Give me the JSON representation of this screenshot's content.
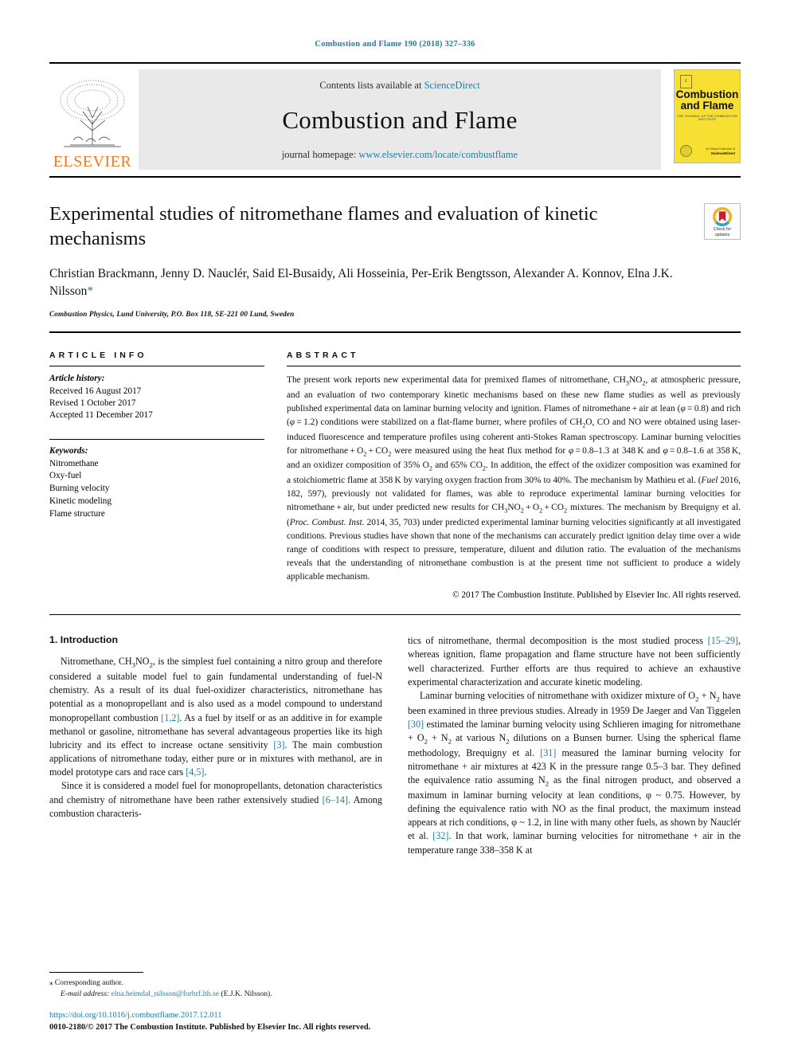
{
  "running_head": "Combustion and Flame 190 (2018) 327–336",
  "masthead": {
    "publisher_name": "ELSEVIER",
    "contents_prefix": "Contents lists available at ",
    "contents_link": "ScienceDirect",
    "journal_title": "Combustion and Flame",
    "homepage_prefix": "journal homepage: ",
    "homepage_link": "www.elsevier.com/locate/combustflame",
    "cover": {
      "title_line1": "Combustion",
      "title_line2": "and Flame",
      "subtitle": "THE JOURNAL OF THE COMBUSTION INSTITUTE",
      "footer_small": "An Official Publication of",
      "footer_bold": "ScienceDirect"
    }
  },
  "article": {
    "title": "Experimental studies of nitromethane flames and evaluation of kinetic mechanisms",
    "authors": "Christian Brackmann, Jenny D. Nauclér, Said El-Busaidy, Ali Hosseinia, Per-Erik Bengtsson, Alexander A. Konnov, Elna J.K. Nilsson",
    "corresponding_marker": "*",
    "affiliation": "Combustion Physics, Lund University, P.O. Box 118, SE-221 00 Lund, Sweden"
  },
  "crossmark": {
    "line1": "Check for",
    "line2": "updates"
  },
  "info": {
    "heading": "ARTICLE INFO",
    "history_label": "Article history:",
    "history": [
      "Received 16 August 2017",
      "Revised 1 October 2017",
      "Accepted 11 December 2017"
    ],
    "keywords_label": "Keywords:",
    "keywords": [
      "Nitromethane",
      "Oxy-fuel",
      "Burning velocity",
      "Kinetic modeling",
      "Flame structure"
    ]
  },
  "abstract": {
    "heading": "ABSTRACT",
    "copyright": "© 2017 The Combustion Institute. Published by Elsevier Inc. All rights reserved."
  },
  "intro": {
    "section_title": "1. Introduction",
    "left_p1_a": "Nitromethane, CH",
    "left_p1_b": "3",
    "left_p1_c": "NO",
    "left_p1_d": "2",
    "left_p1_e": ", is the simplest fuel containing a nitro group and therefore considered a suitable model fuel to gain fundamental understanding of fuel-N chemistry. As a result of its dual fuel-oxidizer characteristics, nitromethane has potential as a monopropellant and is also used as a model compound to understand monopropellant combustion ",
    "ref_1_2": "[1,2]",
    "left_p1_f": ". As a fuel by itself or as an additive in for example methanol or gasoline, nitromethane has several advantageous properties like its high lubricity and its effect to increase octane sensitivity ",
    "ref_3": "[3]",
    "left_p1_g": ". The main combustion applications of nitromethane today, either pure or in mixtures with methanol, are in model prototype cars and race cars ",
    "ref_4_5": "[4,5]",
    "left_p1_h": ".",
    "left_p2_a": "Since it is considered a model fuel for monopropellants, detonation characteristics and chemistry of nitromethane have been rather extensively studied ",
    "ref_6_14": "[6–14]",
    "left_p2_b": ". Among combustion characteris-",
    "right_p1_a": "tics of nitromethane, thermal decomposition is the most studied process ",
    "ref_15_29": "[15–29]",
    "right_p1_b": ", whereas ignition, flame propagation and flame structure have not been sufficiently well characterized. Further efforts are thus required to achieve an exhaustive experimental characterization and accurate kinetic modeling.",
    "right_p2_a": "Laminar burning velocities of nitromethane with oxidizer mixture of O",
    "right_p2_b": "2",
    "right_p2_c": " + N",
    "right_p2_d": "2",
    "right_p2_e": " have been examined in three previous studies. Already in 1959 De Jaeger and Van Tiggelen ",
    "ref_30": "[30]",
    "right_p2_f": " estimated the laminar burning velocity using Schlieren imaging for nitromethane + O",
    "right_p2_g": "2",
    "right_p2_h": " + N",
    "right_p2_i": "2",
    "right_p2_j": " at various N",
    "right_p2_k": "2",
    "right_p2_l": " dilutions on a Bunsen burner. Using the spherical flame methodology, Brequigny et al. ",
    "ref_31": "[31]",
    "right_p2_m": " measured the laminar burning velocity for nitromethane + air mixtures at 423 K in the pressure range 0.5–3 bar. They defined the equivalence ratio assuming N",
    "right_p2_n": "2",
    "right_p2_o": " as the final nitrogen product, and observed a maximum in laminar burning velocity at lean conditions, φ ~ 0.75. However, by defining the equivalence ratio with NO as the final product, the maximum instead appears at rich conditions, φ ~ 1.2, in line with many other fuels, as shown by Nauclér et al. ",
    "ref_32": "[32]",
    "right_p2_p": ". In that work, laminar burning velocities for nitromethane + air in the temperature range 338–358 K at"
  },
  "footnote": {
    "corresponding": "Corresponding author.",
    "email_label": "E-mail address:",
    "email": "elna.heimdal_nilsson@forbrf.lth.se",
    "email_owner": "(E.J.K. Nilsson)."
  },
  "page_footer": {
    "doi": "https://doi.org/10.1016/j.combustflame.2017.12.011",
    "issn_line": "0010-2180/© 2017 The Combustion Institute. Published by Elsevier Inc. All rights reserved."
  },
  "colors": {
    "link": "#1a7ea8",
    "elsevier_orange": "#f47920",
    "cover_yellow": "#f7e032",
    "masthead_grey": "#e9e9e9"
  }
}
